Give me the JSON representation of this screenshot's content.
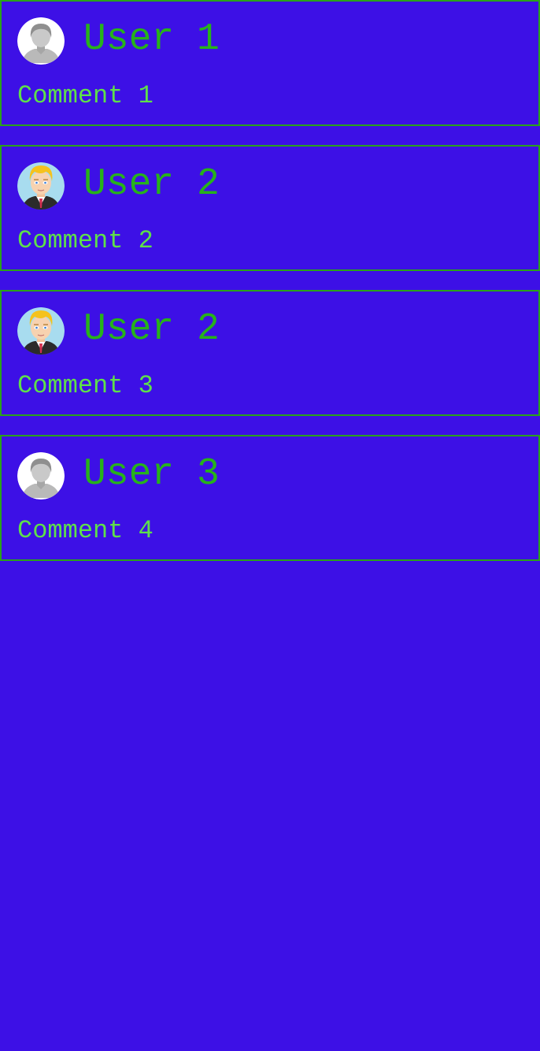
{
  "colors": {
    "background": "#3d10e6",
    "card_border": "#2aa21a",
    "username_text": "#27b21b",
    "comment_text": "#5ee04a"
  },
  "comments": [
    {
      "username": "User 1",
      "comment": "Comment 1",
      "avatar": "default-avatar-icon"
    },
    {
      "username": "User 2",
      "comment": "Comment 2",
      "avatar": "blond-man-avatar-icon"
    },
    {
      "username": "User 2",
      "comment": "Comment 3",
      "avatar": "blond-man-avatar-icon"
    },
    {
      "username": "User 3",
      "comment": "Comment 4",
      "avatar": "default-avatar-icon"
    }
  ]
}
